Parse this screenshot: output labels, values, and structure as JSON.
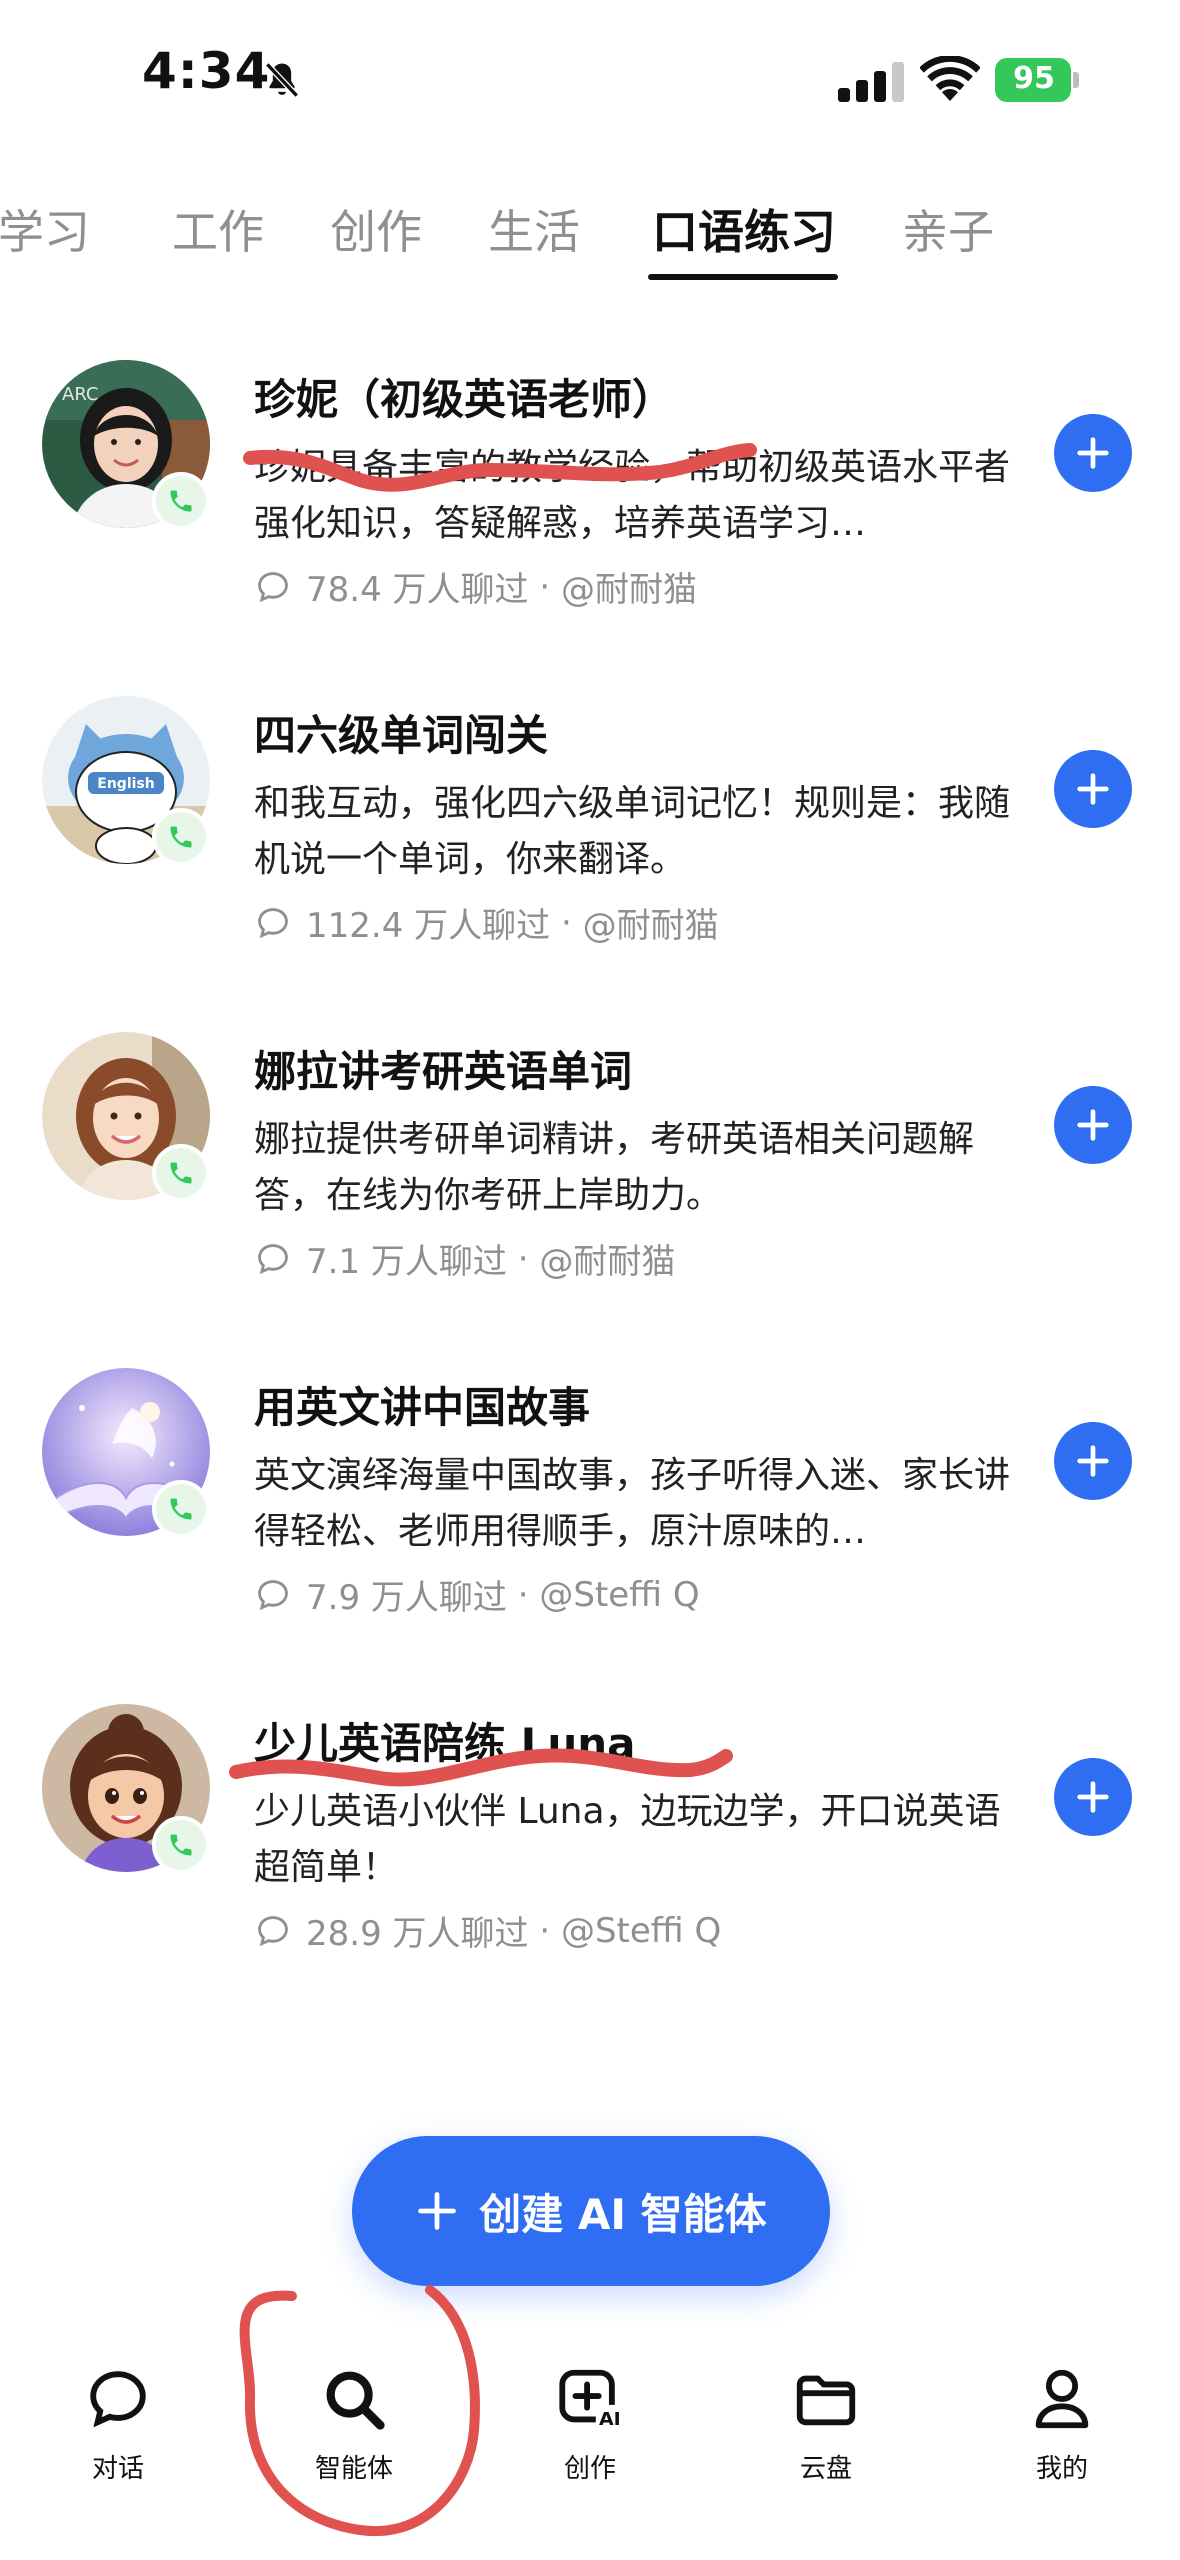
{
  "status_bar": {
    "time": "4:34",
    "battery": "95"
  },
  "tabs": [
    {
      "label": "学习"
    },
    {
      "label": "工作"
    },
    {
      "label": "创作"
    },
    {
      "label": "生活"
    },
    {
      "label": "口语练习",
      "active": true
    },
    {
      "label": "亲子"
    }
  ],
  "agents": [
    {
      "title": "珍妮（初级英语老师）",
      "desc": "珍妮具备丰富的教学经验，帮助初级英语水平者强化知识，答疑解惑，培养英语学习…",
      "chats": "78.4 万人聊过",
      "author": "@耐耐猫"
    },
    {
      "title": "四六级单词闯关",
      "desc": "和我互动，强化四六级单词记忆！规则是：我随机说一个单词，你来翻译。",
      "chats": "112.4 万人聊过",
      "author": "@耐耐猫",
      "avatar_badge": "English"
    },
    {
      "title": "娜拉讲考研英语单词",
      "desc": "娜拉提供考研单词精讲，考研英语相关问题解答，在线为你考研上岸助力。",
      "chats": "7.1 万人聊过",
      "author": "@耐耐猫"
    },
    {
      "title": "用英文讲中国故事",
      "desc": "英文演绎海量中国故事，孩子听得入迷、家长讲得轻松、老师用得顺手，原汁原味的…",
      "chats": "7.9 万人聊过",
      "author": "@Steffi Q"
    },
    {
      "title": "少儿英语陪练 Luna",
      "desc": "少儿英语小伙伴 Luna，边玩边学，开口说英语超简单！",
      "chats": "28.9 万人聊过",
      "author": "@Steffi Q"
    }
  ],
  "meta_separator": "·",
  "create_button": {
    "label": "创建 AI 智能体"
  },
  "bottom_nav": [
    {
      "label": "对话",
      "icon": "chat-bubble-icon"
    },
    {
      "label": "智能体",
      "icon": "search-icon",
      "active": true
    },
    {
      "label": "创作",
      "icon": "create-ai-icon"
    },
    {
      "label": "云盘",
      "icon": "folder-icon"
    },
    {
      "label": "我的",
      "icon": "profile-icon"
    }
  ],
  "colors": {
    "accent": "#2f6df3",
    "markup_red": "#e0524f",
    "battery_green": "#34c759",
    "muted_text": "#8e8e93"
  }
}
